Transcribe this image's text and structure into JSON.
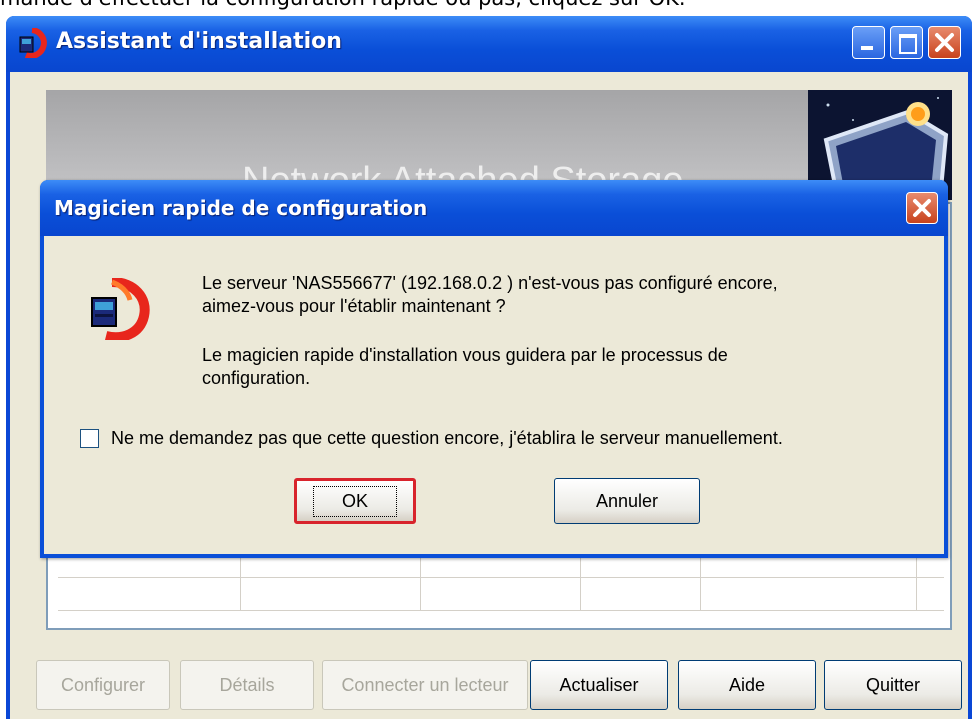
{
  "top_instruction": "mande d'effectuer la configuration rapide ou pas, cliquez sur OK.",
  "main_window": {
    "title": "Assistant d'installation",
    "banner_text": "Network Attached Storage"
  },
  "bottom_buttons": [
    {
      "label": "Configurer",
      "enabled": false
    },
    {
      "label": "Détails",
      "enabled": false
    },
    {
      "label": "Connecter un lecteur",
      "enabled": false
    },
    {
      "label": "Actualiser",
      "enabled": true
    },
    {
      "label": "Aide",
      "enabled": true
    },
    {
      "label": "Quitter",
      "enabled": true
    }
  ],
  "dialog": {
    "title": "Magicien rapide de configuration",
    "message_line1": "Le serveur 'NAS556677' (192.168.0.2 ) n'est-vous pas configuré encore,",
    "message_line2": "aimez-vous pour l'établir maintenant ?",
    "message_line3": "Le magicien rapide d'installation vous guidera par le processus de",
    "message_line4": "configuration.",
    "checkbox_label": "Ne me demandez pas que cette question encore, j'établira le serveur manuellement.",
    "checkbox_checked": false,
    "ok_label": "OK",
    "cancel_label": "Annuler"
  },
  "colors": {
    "titlebar_blue": "#0a4fd8",
    "window_bg": "#ece9d8",
    "ok_highlight": "#d8242c"
  }
}
